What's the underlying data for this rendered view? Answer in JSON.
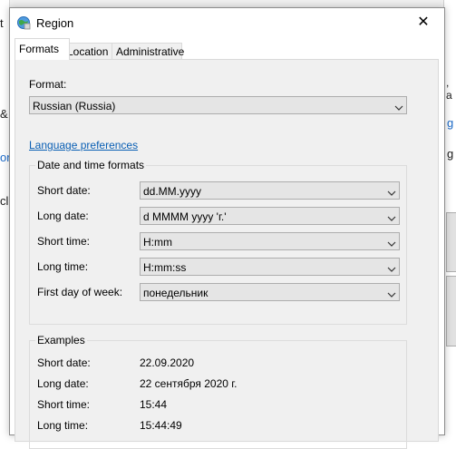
{
  "background": {
    "left_fragments": [
      "t",
      "&",
      "or",
      "cl"
    ],
    "right_fragments": [
      ", a",
      "g",
      "g"
    ]
  },
  "dialog": {
    "title": "Region",
    "close_glyph": "✕"
  },
  "tabs": [
    {
      "label": "Formats",
      "active": true
    },
    {
      "label": "Location",
      "active": false
    },
    {
      "label": "Administrative",
      "active": false
    }
  ],
  "formats": {
    "format_label": "Format:",
    "format_value": "Russian (Russia)",
    "language_link": "Language preferences",
    "datetime_group_title": "Date and time formats",
    "rows": [
      {
        "label": "Short date:",
        "value": "dd.MM.yyyy"
      },
      {
        "label": "Long date:",
        "value": "d MMMM yyyy 'г.'"
      },
      {
        "label": "Short time:",
        "value": "H:mm"
      },
      {
        "label": "Long time:",
        "value": "H:mm:ss"
      },
      {
        "label": "First day of week:",
        "value": "понедельник"
      }
    ],
    "examples_title": "Examples",
    "examples": [
      {
        "label": "Short date:",
        "value": "22.09.2020"
      },
      {
        "label": "Long date:",
        "value": "22 сентября 2020 г."
      },
      {
        "label": "Short time:",
        "value": "15:44"
      },
      {
        "label": "Long time:",
        "value": "15:44:49"
      }
    ]
  },
  "colors": {
    "link": "#0a5fb4",
    "panel_bg": "#f0f0f0",
    "combo_bg": "#e5e5e5"
  },
  "icons": {
    "title": "globe-icon",
    "dropdown": "chevron-down-icon",
    "close": "close-icon"
  }
}
